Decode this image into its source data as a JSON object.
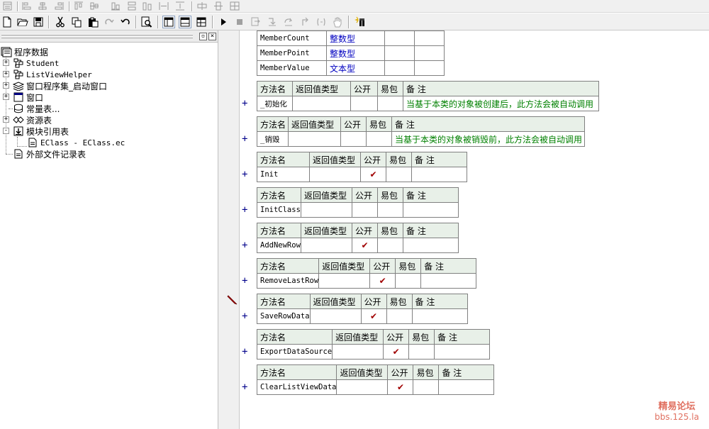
{
  "toolbar1": {
    "icons": [
      "form-icon",
      "align-left-icon",
      "align-center-icon",
      "align-right-icon",
      "align-top-icon",
      "align-middle-icon",
      "align-bottom-icon",
      "same-width-icon",
      "same-height-icon"
    ]
  },
  "toolbar2": {
    "icons": [
      "new-file-icon",
      "open-folder-icon",
      "save-icon",
      "cut-icon",
      "copy-icon",
      "paste-icon",
      "redo-icon",
      "undo-icon",
      "find-icon",
      "layout-left-icon",
      "layout-full-icon",
      "layout-split-icon",
      "run-icon",
      "stop-icon",
      "step-icon",
      "step-into-icon",
      "step-over-icon",
      "step-out-icon",
      "hand-icon",
      "debug-icon"
    ]
  },
  "tree": {
    "root": "程序数据",
    "items": [
      {
        "label": "Student",
        "icon": "class-icon",
        "expander": "+"
      },
      {
        "label": "ListViewHelper",
        "icon": "class-icon",
        "expander": "+"
      },
      {
        "label": "窗口程序集_启动窗口",
        "icon": "assembly-icon",
        "expander": "+"
      },
      {
        "label": "窗口",
        "icon": "window-icon",
        "expander": "+"
      },
      {
        "label": "常量表...",
        "icon": "constant-icon",
        "expander": ""
      },
      {
        "label": "资源表",
        "icon": "resource-icon",
        "expander": "+"
      },
      {
        "label": "模块引用表",
        "icon": "module-icon",
        "expander": "-"
      },
      {
        "label": "EClass - EClass.ec",
        "icon": "file-icon",
        "expander": ""
      },
      {
        "label": "外部文件记录表",
        "icon": "file-icon",
        "expander": ""
      }
    ]
  },
  "members": {
    "rows": [
      {
        "name": "MemberCount",
        "type": "整数型"
      },
      {
        "name": "MemberPoint",
        "type": "整数型"
      },
      {
        "name": "MemberValue",
        "type": "文本型"
      }
    ]
  },
  "method_headers": {
    "name": "方法名",
    "return_type": "返回值类型",
    "public": "公开",
    "easy_pack": "易包",
    "remark": "备 注"
  },
  "methods": [
    {
      "name": "_初始化",
      "public": false,
      "remark": "当基于本类的对象被创建后，此方法会被自动调用"
    },
    {
      "name": "_销毁",
      "public": false,
      "remark": "当基于本类的对象被销毁前，此方法会被自动调用"
    },
    {
      "name": "Init",
      "public": true,
      "remark": ""
    },
    {
      "name": "InitClass",
      "public": false,
      "remark": ""
    },
    {
      "name": "AddNewRow",
      "public": true,
      "remark": ""
    },
    {
      "name": "RemoveLastRow",
      "public": true,
      "remark": ""
    },
    {
      "name": "SaveRowData",
      "public": true,
      "remark": ""
    },
    {
      "name": "ExportDataSource",
      "public": true,
      "remark": ""
    },
    {
      "name": "ClearListViewData",
      "public": true,
      "remark": ""
    }
  ],
  "check_mark": "✔",
  "plus_mark": "+",
  "watermark": {
    "line1": "精易论坛",
    "line2": "bbs.125.la"
  }
}
